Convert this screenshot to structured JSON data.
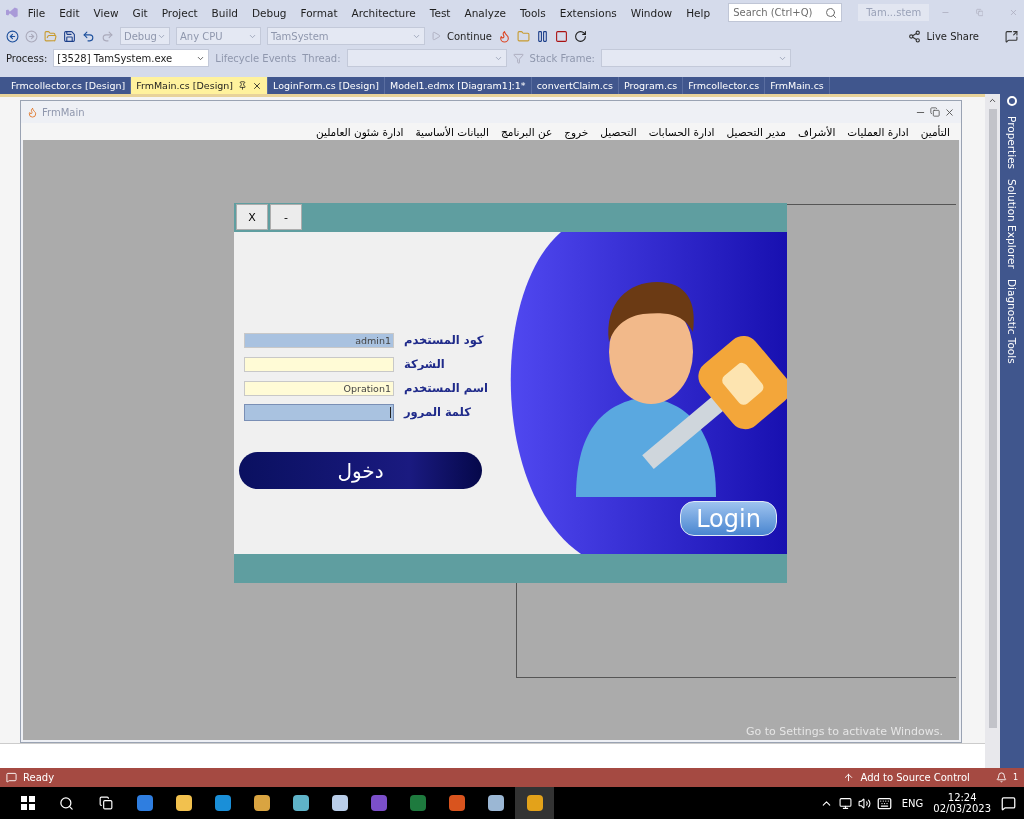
{
  "menu_bar": {
    "items": [
      "File",
      "Edit",
      "View",
      "Git",
      "Project",
      "Build",
      "Debug",
      "Format",
      "Architecture",
      "Test",
      "Analyze",
      "Tools",
      "Extensions",
      "Window",
      "Help"
    ],
    "search": {
      "placeholder": "Search (Ctrl+Q)"
    },
    "solution_name": "Tam...stem"
  },
  "toolbar": {
    "configuration": "Debug",
    "platform": "Any CPU",
    "startup_project": "TamSystem",
    "continue": "Continue",
    "live_share": "Live Share"
  },
  "debug_toolbar": {
    "process_label": "Process:",
    "process": "[3528] TamSystem.exe",
    "lifecycle": "Lifecycle Events",
    "thread_label": "Thread:",
    "stack_frame_label": "Stack Frame:"
  },
  "tabs": [
    {
      "label": "Frmcollector.cs [Design]",
      "selected": false
    },
    {
      "label": "FrmMain.cs [Design]",
      "selected": true
    },
    {
      "label": "LoginForm.cs [Design]",
      "selected": false
    },
    {
      "label": "Model1.edmx [Diagram1]:1*",
      "selected": false
    },
    {
      "label": "convertClaim.cs",
      "selected": false
    },
    {
      "label": "Program.cs",
      "selected": false
    },
    {
      "label": "Frmcollector.cs",
      "selected": false
    },
    {
      "label": "FrmMain.cs",
      "selected": false
    }
  ],
  "side_panels": [
    "Properties",
    "Solution Explorer",
    "Diagnostic Tools"
  ],
  "form": {
    "title": "FrmMain",
    "menu": [
      "التأمين",
      "ادارة العمليات",
      "الأشراف",
      "مدير التحصيل",
      "ادارة الحسابات",
      "التحصيل",
      "خروج",
      "عن البرنامج",
      "البيانات الأساسية",
      "ادارة شئون العاملين"
    ],
    "login": {
      "close": "X",
      "minimize": "-",
      "fields": [
        {
          "label": "كود المستخدم",
          "value": "admin1",
          "kind": "highlight",
          "focused": false
        },
        {
          "label": "الشركة",
          "kind": "autofill",
          "focused": false
        },
        {
          "label": "اسم المستخدم",
          "value": "Opration1",
          "kind": "autofill",
          "focused": false
        },
        {
          "label": "كلمة المرور",
          "kind": "highlight",
          "focused": true
        }
      ],
      "submit": "دخول",
      "badge": "Login"
    }
  },
  "activation_notice": "Go to Settings to activate Windows.",
  "status_bar": {
    "status": "Ready",
    "source_control": "Add to Source Control",
    "notifications": "1"
  },
  "taskbar": {
    "language": "ENG",
    "time": "12:24",
    "date": "02/03/2023"
  }
}
